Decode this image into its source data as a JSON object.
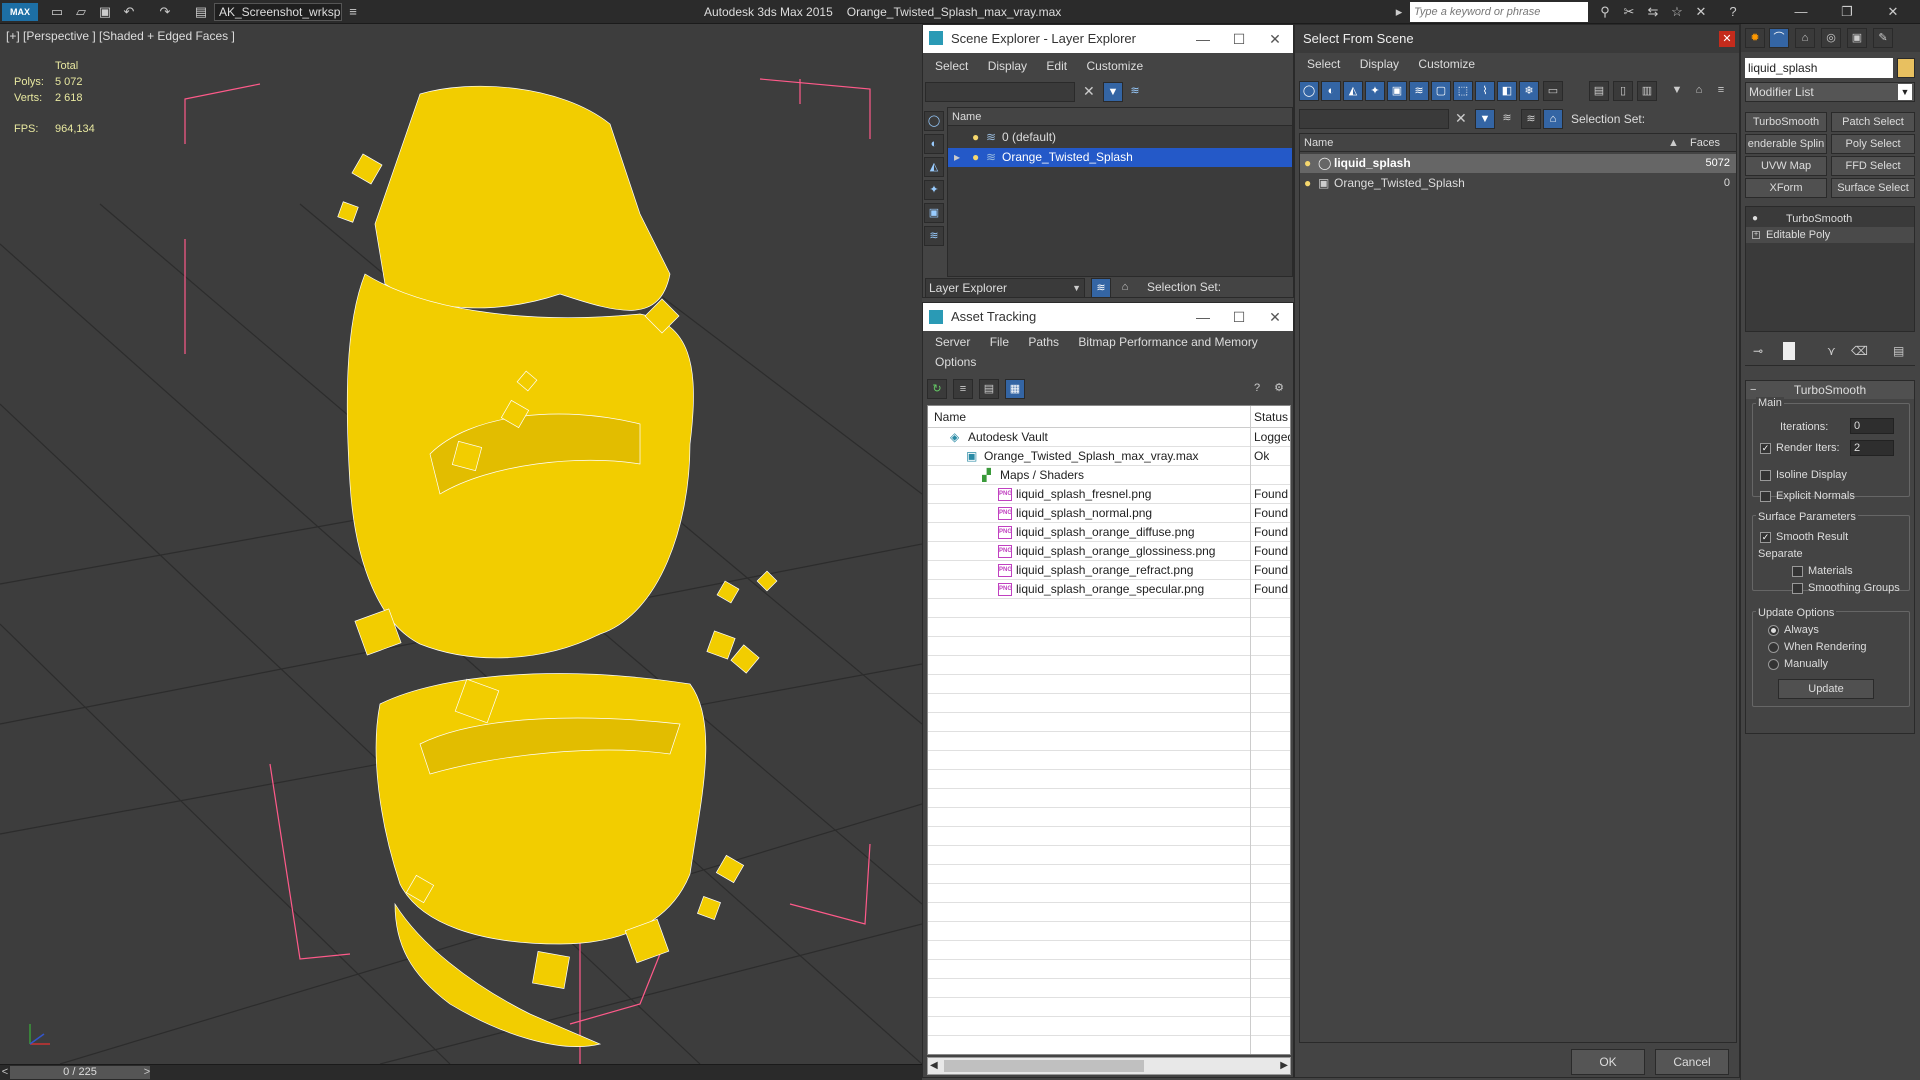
{
  "titlebar": {
    "logo": "MAX",
    "workspace": "AK_Screenshot_wrksp",
    "app_name": "Autodesk 3ds Max  2015",
    "file_name": "Orange_Twisted_Splash_max_vray.max",
    "search_placeholder": "Type a keyword or phrase"
  },
  "viewport": {
    "label": "[+] [Perspective ] [Shaded + Edged Faces ]",
    "stats": {
      "total_label": "Total",
      "polys_label": "Polys:",
      "polys_value": "5 072",
      "verts_label": "Verts:",
      "verts_value": "2 618",
      "fps_label": "FPS:",
      "fps_value": "964,134"
    },
    "colors": {
      "background": "#3d3d3d",
      "mesh": "#f5d000",
      "wire": "#ffffff",
      "grid": "#2b2b2b",
      "bbox": "#ff5a8a"
    }
  },
  "timeline": {
    "frame": "0 / 225",
    "prev": "<",
    "next": ">"
  },
  "scene_explorer": {
    "title": "Scene Explorer - Layer Explorer",
    "menu": [
      "Select",
      "Display",
      "Edit",
      "Customize"
    ],
    "column_name": "Name",
    "layers": [
      {
        "name": "0 (default)",
        "selected": false
      },
      {
        "name": "Orange_Twisted_Splash",
        "selected": true
      }
    ],
    "footer_dropdown": "Layer Explorer",
    "selection_set_label": "Selection Set:"
  },
  "asset_tracking": {
    "title": "Asset Tracking",
    "menu": [
      "Server",
      "File",
      "Paths",
      "Bitmap Performance and Memory"
    ],
    "menu_row2": [
      "Options"
    ],
    "col_name": "Name",
    "col_status": "Status",
    "rows": [
      {
        "name": "Autodesk Vault",
        "status": "Logged",
        "indent": 1,
        "icon": "vault-icon"
      },
      {
        "name": "Orange_Twisted_Splash_max_vray.max",
        "status": "Ok",
        "indent": 2,
        "icon": "max-file-icon"
      },
      {
        "name": "Maps / Shaders",
        "status": "",
        "indent": 3,
        "icon": "maps-icon"
      },
      {
        "name": "liquid_splash_fresnel.png",
        "status": "Found",
        "indent": 4,
        "icon": "png-icon"
      },
      {
        "name": "liquid_splash_normal.png",
        "status": "Found",
        "indent": 4,
        "icon": "png-icon"
      },
      {
        "name": "liquid_splash_orange_diffuse.png",
        "status": "Found",
        "indent": 4,
        "icon": "png-icon"
      },
      {
        "name": "liquid_splash_orange_glossiness.png",
        "status": "Found",
        "indent": 4,
        "icon": "png-icon"
      },
      {
        "name": "liquid_splash_orange_refract.png",
        "status": "Found",
        "indent": 4,
        "icon": "png-icon"
      },
      {
        "name": "liquid_splash_orange_specular.png",
        "status": "Found",
        "indent": 4,
        "icon": "png-icon"
      }
    ],
    "png_badge": "PNG"
  },
  "select_from_scene": {
    "title": "Select From Scene",
    "menu": [
      "Select",
      "Display",
      "Customize"
    ],
    "selection_set_label": "Selection Set:",
    "col_name": "Name",
    "col_faces": "Faces",
    "rows": [
      {
        "name": "liquid_splash",
        "faces": "5072",
        "selected": true
      },
      {
        "name": "Orange_Twisted_Splash",
        "faces": "0",
        "selected": false
      }
    ],
    "ok": "OK",
    "cancel": "Cancel"
  },
  "command_panel": {
    "object_name": "liquid_splash",
    "modifier_list": "Modifier List",
    "buttons": [
      [
        "TurboSmooth",
        "Patch Select"
      ],
      [
        "enderable Splin",
        "Poly Select"
      ],
      [
        "UVW Map",
        "FFD Select"
      ],
      [
        "XForm",
        "Surface Select"
      ]
    ],
    "stack": [
      "TurboSmooth",
      "Editable Poly"
    ],
    "rollout": {
      "title": "TurboSmooth",
      "main": "Main",
      "iterations_label": "Iterations:",
      "iterations": "0",
      "render_iters_label": "Render Iters:",
      "render_iters": "2",
      "isoline": "Isoline Display",
      "explicit_normals": "Explicit Normals",
      "surface_params": "Surface Parameters",
      "smooth_result": "Smooth Result",
      "separate": "Separate",
      "materials": "Materials",
      "smoothing_groups": "Smoothing Groups",
      "update_options": "Update Options",
      "always": "Always",
      "when_rendering": "When Rendering",
      "manually": "Manually",
      "update": "Update"
    }
  }
}
